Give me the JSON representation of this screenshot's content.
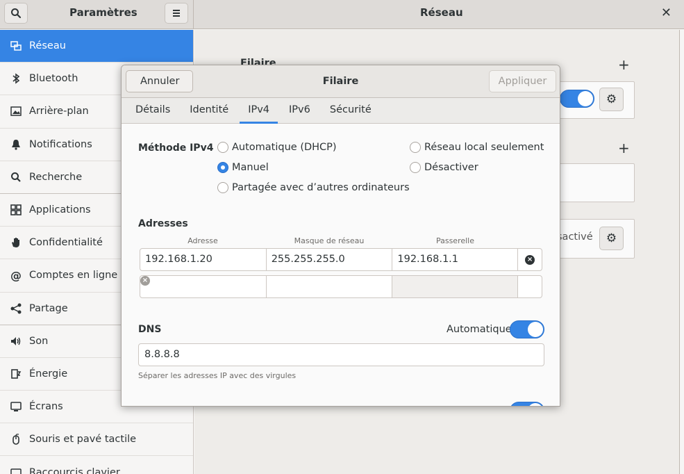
{
  "header": {
    "sidebar_title": "Paramètres",
    "main_title": "Réseau",
    "close_glyph": "✕"
  },
  "sidebar": {
    "items": [
      {
        "label": "Réseau",
        "icon": "network-icon"
      },
      {
        "label": "Bluetooth",
        "icon": "bluetooth-icon"
      },
      {
        "label": "Arrière-plan",
        "icon": "background-icon"
      },
      {
        "label": "Notifications",
        "icon": "bell-icon"
      },
      {
        "label": "Recherche",
        "icon": "search-icon"
      },
      {
        "label": "Applications",
        "icon": "applications-icon"
      },
      {
        "label": "Confidentialité",
        "icon": "hand-icon"
      },
      {
        "label": "Comptes en ligne",
        "icon": "at-icon"
      },
      {
        "label": "Partage",
        "icon": "share-icon"
      },
      {
        "label": "Son",
        "icon": "speaker-icon"
      },
      {
        "label": "Énergie",
        "icon": "power-icon"
      },
      {
        "label": "Écrans",
        "icon": "display-icon"
      },
      {
        "label": "Souris et pavé tactile",
        "icon": "mouse-icon"
      },
      {
        "label": "Raccourcis clavier",
        "icon": "keyboard-icon"
      }
    ]
  },
  "main": {
    "wired_heading": "Filaire",
    "plus_glyph": "+",
    "disabled_label": "sactivé"
  },
  "dialog": {
    "cancel_label": "Annuler",
    "title": "Filaire",
    "apply_label": "Appliquer",
    "tabs": [
      {
        "label": "Détails"
      },
      {
        "label": "Identité"
      },
      {
        "label": "IPv4"
      },
      {
        "label": "IPv6"
      },
      {
        "label": "Sécurité"
      }
    ],
    "active_tab": "IPv4",
    "method_label": "Méthode IPv4",
    "methods": {
      "dhcp": "Automatique (DHCP)",
      "local": "Réseau local seulement",
      "manual": "Manuel",
      "disable": "Désactiver",
      "shared": "Partagée avec d’autres ordinateurs"
    },
    "selected_method": "Manuel",
    "addresses_label": "Adresses",
    "columns": {
      "address": "Adresse",
      "netmask": "Masque de réseau",
      "gateway": "Passerelle"
    },
    "rows": [
      {
        "address": "192.168.1.20",
        "netmask": "255.255.255.0",
        "gateway": "192.168.1.1"
      },
      {
        "address": "",
        "netmask": "",
        "gateway": ""
      }
    ],
    "dns_label": "DNS",
    "dns_auto_label": "Automatique",
    "dns_auto_on": true,
    "dns_value": "8.8.8.8",
    "dns_hint": "Séparer les adresses IP avec des virgules"
  },
  "colors": {
    "accent": "#3584e4"
  }
}
